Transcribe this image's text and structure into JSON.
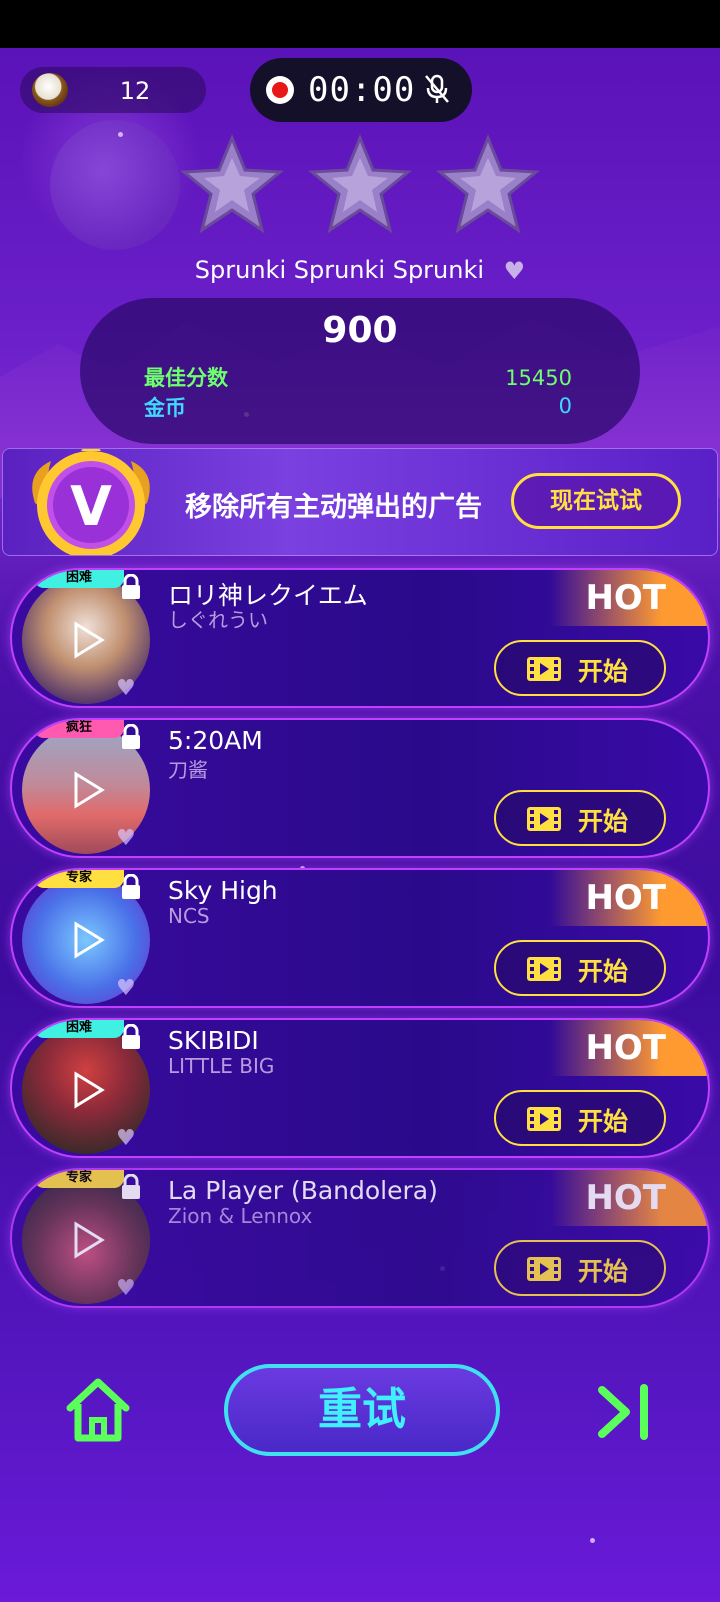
{
  "hud": {
    "coin_count": "12",
    "record_time": "00:00"
  },
  "result": {
    "song_title": "Sprunki Sprunki Sprunki",
    "score": "900",
    "best_label": "最佳分数",
    "best_value": "15450",
    "coins_label": "金币",
    "coins_value": "0",
    "stars_earned": 0,
    "stars_total": 3
  },
  "vip": {
    "badge_letter": "V",
    "text": "移除所有主动弹出的广告",
    "button": "现在试试"
  },
  "songs": [
    {
      "title": "ロリ神レクイエム",
      "artist": "しぐれうい",
      "difficulty": "困难",
      "difficulty_color": "#40f0e0",
      "hot": "HOT",
      "start": "开始"
    },
    {
      "title": "5:20AM",
      "artist": "刀酱",
      "difficulty": "疯狂",
      "difficulty_color": "#ff5ab0",
      "hot": "",
      "start": "开始"
    },
    {
      "title": "Sky High",
      "artist": "NCS",
      "difficulty": "专家",
      "difficulty_color": "#ffe040",
      "hot": "HOT",
      "start": "开始"
    },
    {
      "title": "SKIBIDI",
      "artist": "LITTLE BIG",
      "difficulty": "困难",
      "difficulty_color": "#40f0e0",
      "hot": "HOT",
      "start": "开始"
    },
    {
      "title": "La Player (Bandolera)",
      "artist": "Zion & Lennox",
      "difficulty": "专家",
      "difficulty_color": "#ffe040",
      "hot": "HOT",
      "start": "开始"
    }
  ],
  "bottom": {
    "retry": "重试"
  },
  "icons": {
    "home": "home-icon",
    "next": "skip-next-icon",
    "mic": "mic-off-icon",
    "record": "record-icon",
    "lock": "lock-icon",
    "play": "play-icon",
    "video": "video-ad-icon",
    "heart": "heart-icon",
    "star": "star-icon"
  },
  "colors": {
    "accent_yellow": "#ffe040",
    "accent_cyan": "#40e0f0",
    "best_green": "#6eff6e",
    "coin_blue": "#40d8ff",
    "hot_orange": "#ff9a30"
  }
}
